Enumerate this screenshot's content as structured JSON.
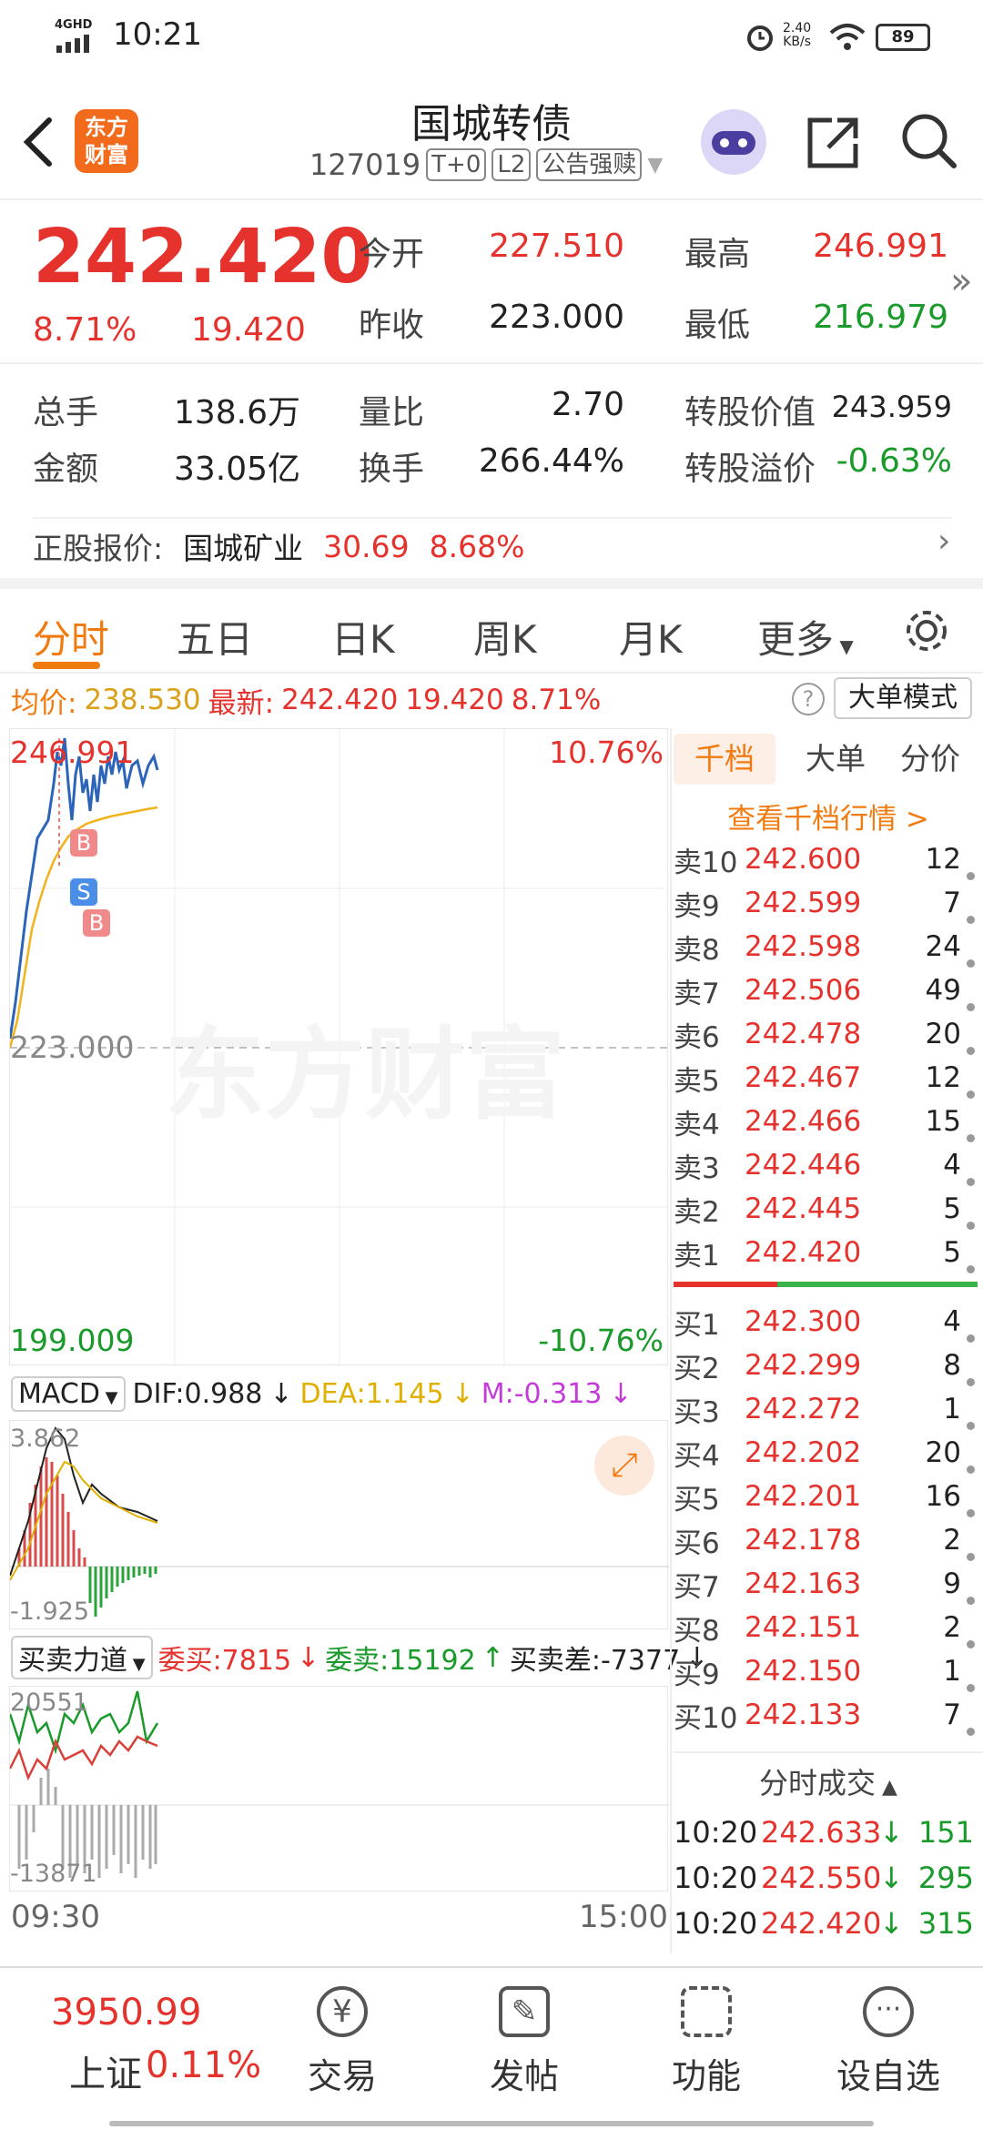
{
  "status": {
    "net": "4GHD",
    "time": "10:21",
    "speed": "2.40",
    "speed_unit": "KB/s",
    "battery": "89"
  },
  "header": {
    "title": "国城转债",
    "code": "127019",
    "tag_t0": "T+0",
    "tag_l2": "L2",
    "tag_notice": "公告强赎",
    "logo": "东方财富"
  },
  "quote": {
    "price": "242.420",
    "change_pct": "8.71%",
    "change": "19.420",
    "open_label": "今开",
    "open": "227.510",
    "prev_label": "昨收",
    "prev": "223.000",
    "high_label": "最高",
    "high": "246.991",
    "low_label": "最低",
    "low": "216.979",
    "vol_label": "总手",
    "vol": "138.6万",
    "amt_label": "金额",
    "amt": "33.05亿",
    "ratio_label": "量比",
    "ratio": "2.70",
    "turn_label": "换手",
    "turn": "266.44%",
    "conv_label": "转股价值",
    "conv": "243.959",
    "prem_label": "转股溢价",
    "prem": "-0.63%",
    "stock_label": "正股报价:",
    "stock_name": "国城矿业",
    "stock_price": "30.69",
    "stock_pct": "8.68%"
  },
  "tabs": [
    "分时",
    "五日",
    "日K",
    "周K",
    "月K",
    "更多"
  ],
  "infoline": {
    "avg_label": "均价:",
    "avg": "238.530",
    "last_label": "最新:",
    "last": "242.420",
    "chg": "19.420",
    "pct": "8.71%",
    "mode": "大单模式"
  },
  "chart": {
    "top_price": "246.991",
    "top_pct": "10.76%",
    "mid_price": "223.000",
    "bot_price": "199.009",
    "bot_pct": "-10.76%",
    "watermark": "东方财富",
    "time_start": "09:30",
    "time_end": "15:00",
    "markers": [
      "B",
      "S",
      "B"
    ]
  },
  "macd": {
    "label": "MACD",
    "dif": "DIF:0.988",
    "dea": "DEA:1.145",
    "m": "M:-0.313",
    "top": "3.862",
    "bot": "-1.925"
  },
  "flow": {
    "label": "买卖力道",
    "buy": "委买:7815",
    "sell": "委卖:15192",
    "diff": "买卖差:-7377",
    "top": "20551",
    "bot": "-13871"
  },
  "book": {
    "tabs": [
      "千档",
      "大单",
      "分价"
    ],
    "link": "查看千档行情 >",
    "sell": [
      {
        "l": "卖10",
        "p": "242.600",
        "v": "12"
      },
      {
        "l": "卖9",
        "p": "242.599",
        "v": "7"
      },
      {
        "l": "卖8",
        "p": "242.598",
        "v": "24"
      },
      {
        "l": "卖7",
        "p": "242.506",
        "v": "49"
      },
      {
        "l": "卖6",
        "p": "242.478",
        "v": "20"
      },
      {
        "l": "卖5",
        "p": "242.467",
        "v": "12"
      },
      {
        "l": "卖4",
        "p": "242.466",
        "v": "15"
      },
      {
        "l": "卖3",
        "p": "242.446",
        "v": "4"
      },
      {
        "l": "卖2",
        "p": "242.445",
        "v": "5"
      },
      {
        "l": "卖1",
        "p": "242.420",
        "v": "5"
      }
    ],
    "buy": [
      {
        "l": "买1",
        "p": "242.300",
        "v": "4"
      },
      {
        "l": "买2",
        "p": "242.299",
        "v": "8"
      },
      {
        "l": "买3",
        "p": "242.272",
        "v": "1"
      },
      {
        "l": "买4",
        "p": "242.202",
        "v": "20"
      },
      {
        "l": "买5",
        "p": "242.201",
        "v": "16"
      },
      {
        "l": "买6",
        "p": "242.178",
        "v": "2"
      },
      {
        "l": "买7",
        "p": "242.163",
        "v": "9"
      },
      {
        "l": "买8",
        "p": "242.151",
        "v": "2"
      },
      {
        "l": "买9",
        "p": "242.150",
        "v": "1"
      },
      {
        "l": "买10",
        "p": "242.133",
        "v": "7"
      }
    ],
    "ticks_title": "分时成交",
    "ticks": [
      {
        "t": "10:20",
        "p": "242.633",
        "v": "151"
      },
      {
        "t": "10:20",
        "p": "242.550",
        "v": "295"
      },
      {
        "t": "10:20",
        "p": "242.420",
        "v": "315"
      }
    ]
  },
  "bottom": {
    "index_value": "3950.99",
    "index_name": "上证",
    "index_pct": "0.11%",
    "nav": [
      "交易",
      "发帖",
      "功能",
      "设自选"
    ]
  }
}
